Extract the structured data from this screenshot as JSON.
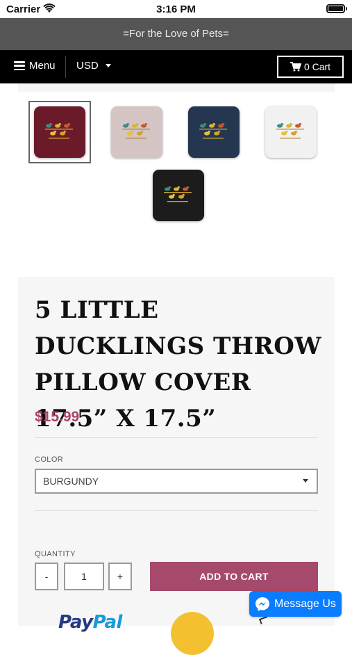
{
  "status_bar": {
    "carrier": "Carrier",
    "time": "3:16 PM"
  },
  "announcement": {
    "text": "=For the Love of Pets="
  },
  "nav": {
    "menu_label": "Menu",
    "currency": "USD",
    "cart_label": "0 Cart"
  },
  "thumbnails": [
    {
      "color_name": "burgundy",
      "color": "#6b1a2a",
      "selected": true
    },
    {
      "color_name": "pink",
      "color": "#d4c4c4",
      "selected": false
    },
    {
      "color_name": "navy",
      "color": "#243650",
      "selected": false
    },
    {
      "color_name": "white",
      "color": "#f1f1f1",
      "selected": false
    },
    {
      "color_name": "black",
      "color": "#1c1c1c",
      "selected": false
    }
  ],
  "product": {
    "title": "5 LITTLE DUCKLINGS THROW PILLOW COVER 17.5” X 17.5”",
    "price": "$15.99",
    "color_label": "COLOR",
    "color_selected": "BURGUNDY",
    "quantity_label": "QUANTITY",
    "quantity_value": "1",
    "qty_minus": "-",
    "qty_plus": "+",
    "add_to_cart": "ADD TO CART"
  },
  "badges": {
    "paypal_part1": "Pay",
    "paypal_part2": "Pal"
  },
  "messenger": {
    "label": "Message Us"
  },
  "colors": {
    "accent": "#a54a6c",
    "price": "#a8446a",
    "announcement_bg": "#555555",
    "nav_bg": "#000000",
    "messenger": "#0a7cff"
  }
}
